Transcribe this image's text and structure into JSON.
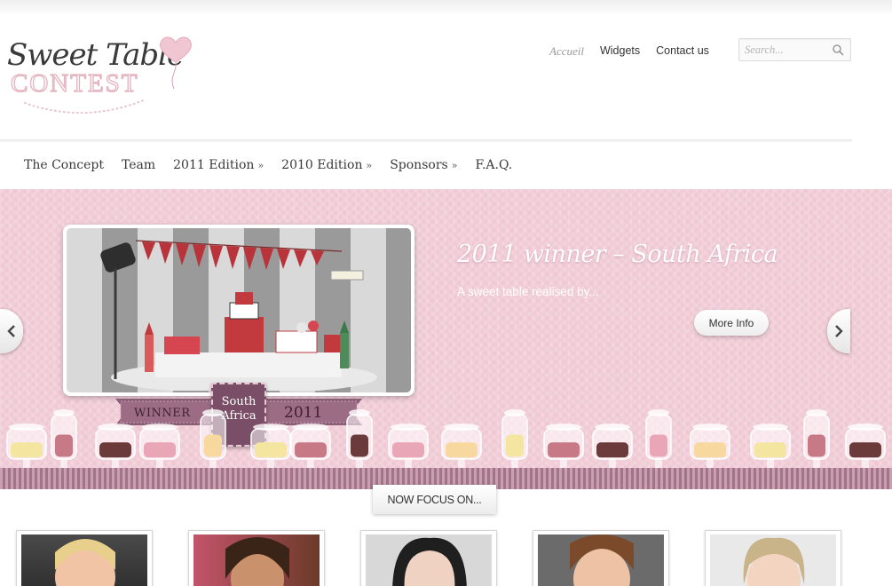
{
  "logo": {
    "line1": "Sweet Table",
    "line2": "CONTEST"
  },
  "top_nav": {
    "items": [
      {
        "label": "Accueil",
        "active": true
      },
      {
        "label": "Widgets",
        "active": false
      },
      {
        "label": "Contact us",
        "active": false
      }
    ]
  },
  "search": {
    "placeholder": "Search..."
  },
  "main_nav": {
    "items": [
      {
        "label": "The Concept",
        "has_submenu": false
      },
      {
        "label": "Team",
        "has_submenu": false
      },
      {
        "label": "2011 Edition",
        "has_submenu": true
      },
      {
        "label": "2010 Edition",
        "has_submenu": true
      },
      {
        "label": "Sponsors",
        "has_submenu": true
      },
      {
        "label": "F.A.Q.",
        "has_submenu": false
      }
    ],
    "submenu_glyph": "»"
  },
  "slider": {
    "heading": "2011 winner – South Africa",
    "subtitle": "A sweet table realised by...",
    "more_info_label": "More Info",
    "badge": {
      "left": "WINNER",
      "center_line1": "South",
      "center_line2": "Africa",
      "right": "2011"
    },
    "prev_icon": "chevron-left-icon",
    "next_icon": "chevron-right-icon"
  },
  "focus": {
    "label": "NOW FOCUS ON..."
  },
  "colors": {
    "band_pink": "#efc8d4",
    "ribbon_purple": "#7b4e67",
    "logo_pink": "#e4b3c0"
  }
}
